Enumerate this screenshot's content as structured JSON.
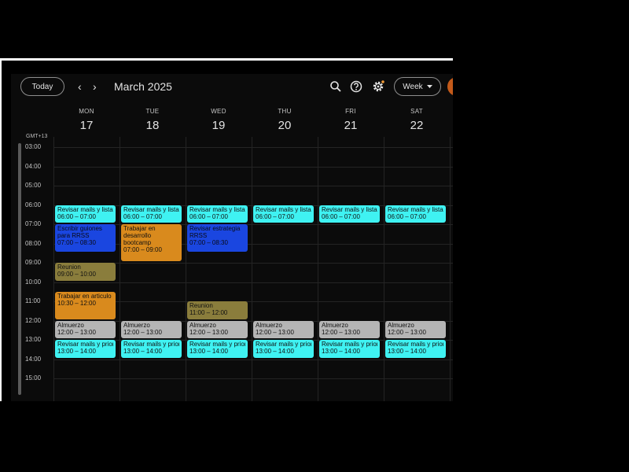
{
  "header": {
    "today_label": "Today",
    "month_title": "March 2025",
    "view_label": "Week"
  },
  "timezone": "GMT+13",
  "days": [
    {
      "name": "MON",
      "num": "17"
    },
    {
      "name": "TUE",
      "num": "18"
    },
    {
      "name": "WED",
      "num": "19"
    },
    {
      "name": "THU",
      "num": "20"
    },
    {
      "name": "FRI",
      "num": "21"
    },
    {
      "name": "SAT",
      "num": "22"
    }
  ],
  "hours": [
    "03:00",
    "04:00",
    "05:00",
    "06:00",
    "07:00",
    "08:00",
    "09:00",
    "10:00",
    "11:00",
    "12:00",
    "13:00",
    "14:00",
    "15:00"
  ],
  "colors": {
    "cyan": "#3ff2f2",
    "blue": "#1a46e0",
    "orange": "#d98a1d",
    "olive": "#8a7d3c",
    "gray": "#b5b5b5"
  },
  "events": [
    {
      "day": 0,
      "title": "Revisar mails y lista d",
      "time": "06:00 – 07:00",
      "color": "cyan"
    },
    {
      "day": 0,
      "title": "Escribir guiones para RRSS",
      "time": "07:00 – 08:30",
      "color": "blue"
    },
    {
      "day": 0,
      "title": "Reunion",
      "time": "09:00 – 10:00",
      "color": "olive"
    },
    {
      "day": 0,
      "title": "Trabajar en articulo",
      "time": "10:30 – 12:00",
      "color": "orange"
    },
    {
      "day": 0,
      "title": "Almuerzo",
      "time": "12:00 – 13:00",
      "color": "gray"
    },
    {
      "day": 0,
      "title": "Revisar mails y priori",
      "time": "13:00 – 14:00",
      "color": "cyan"
    },
    {
      "day": 1,
      "title": "Revisar mails y lista d",
      "time": "06:00 – 07:00",
      "color": "cyan"
    },
    {
      "day": 1,
      "title": "Trabajar en desarrollo bootcamp",
      "time": "07:00 – 09:00",
      "color": "orange"
    },
    {
      "day": 1,
      "title": "Almuerzo",
      "time": "12:00 – 13:00",
      "color": "gray"
    },
    {
      "day": 1,
      "title": "Revisar mails y priori",
      "time": "13:00 – 14:00",
      "color": "cyan"
    },
    {
      "day": 2,
      "title": "Revisar mails y lista d",
      "time": "06:00 – 07:00",
      "color": "cyan"
    },
    {
      "day": 2,
      "title": "Revisar estrategia RRSS",
      "time": "07:00 – 08:30",
      "color": "blue"
    },
    {
      "day": 2,
      "title": "Reunion",
      "time": "11:00 – 12:00",
      "color": "olive"
    },
    {
      "day": 2,
      "title": "Almuerzo",
      "time": "12:00 – 13:00",
      "color": "gray"
    },
    {
      "day": 2,
      "title": "Revisar mails y priori",
      "time": "13:00 – 14:00",
      "color": "cyan"
    },
    {
      "day": 3,
      "title": "Revisar mails y lista d",
      "time": "06:00 – 07:00",
      "color": "cyan"
    },
    {
      "day": 3,
      "title": "Almuerzo",
      "time": "12:00 – 13:00",
      "color": "gray"
    },
    {
      "day": 3,
      "title": "Revisar mails y priori",
      "time": "13:00 – 14:00",
      "color": "cyan"
    },
    {
      "day": 4,
      "title": "Revisar mails y lista d",
      "time": "06:00 – 07:00",
      "color": "cyan"
    },
    {
      "day": 4,
      "title": "Almuerzo",
      "time": "12:00 – 13:00",
      "color": "gray"
    },
    {
      "day": 4,
      "title": "Revisar mails y priori",
      "time": "13:00 – 14:00",
      "color": "cyan"
    },
    {
      "day": 5,
      "title": "Revisar mails y lista d",
      "time": "06:00 – 07:00",
      "color": "cyan"
    },
    {
      "day": 5,
      "title": "Almuerzo",
      "time": "12:00 – 13:00",
      "color": "gray"
    },
    {
      "day": 5,
      "title": "Revisar mails y priori",
      "time": "13:00 – 14:00",
      "color": "cyan"
    }
  ]
}
